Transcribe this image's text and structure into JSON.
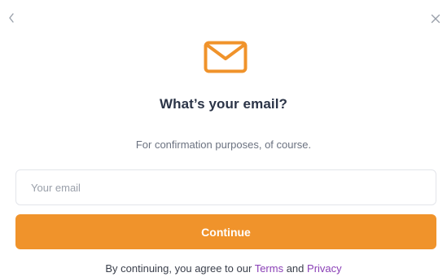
{
  "nav": {
    "back_icon": "chevron-left-icon",
    "close_icon": "close-icon"
  },
  "header": {
    "icon": "mail-icon",
    "title": "What’s your email?",
    "subtitle": "For confirmation purposes, of course."
  },
  "form": {
    "email_placeholder": "Your email",
    "email_value": "",
    "continue_label": "Continue"
  },
  "legal": {
    "prefix": "By continuing, you agree to our",
    "terms_label": "Terms",
    "conjunction": "and",
    "privacy_label": "Privacy"
  },
  "colors": {
    "accent": "#f0932b",
    "link": "#8a3fb6",
    "title": "#2b3447"
  }
}
